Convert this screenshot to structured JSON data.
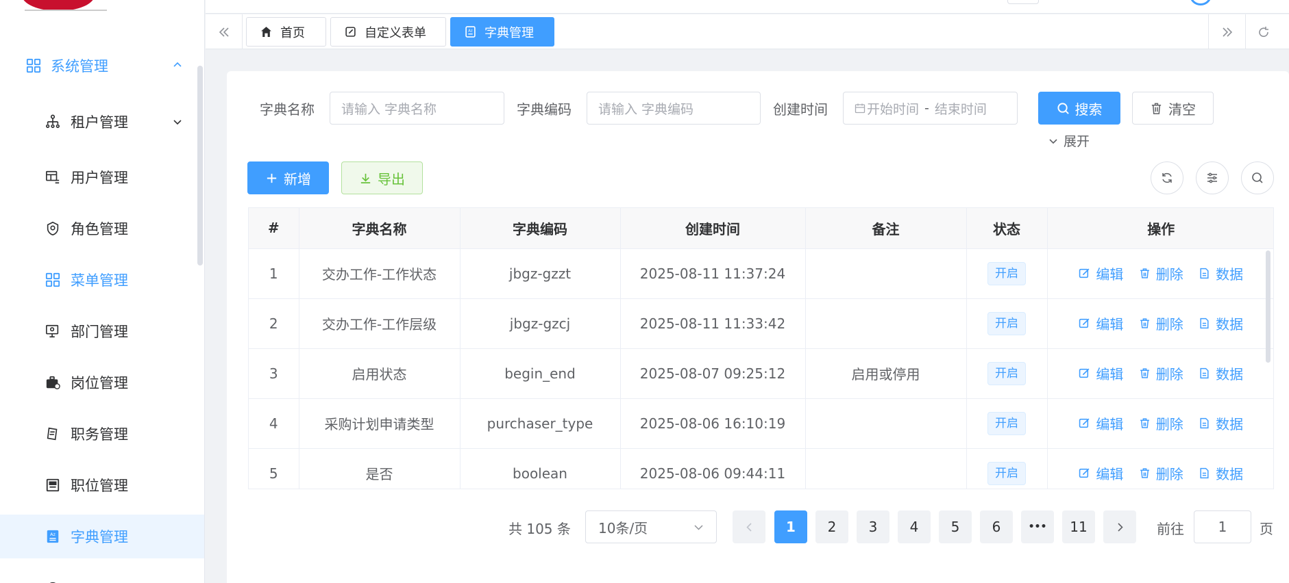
{
  "sidebar": {
    "group": {
      "label": "系统管理"
    },
    "items": [
      {
        "label": "租户管理"
      },
      {
        "label": "用户管理"
      },
      {
        "label": "角色管理"
      },
      {
        "label": "菜单管理"
      },
      {
        "label": "部门管理"
      },
      {
        "label": "岗位管理"
      },
      {
        "label": "职务管理"
      },
      {
        "label": "职位管理"
      },
      {
        "label": "字典管理"
      }
    ]
  },
  "tabs": [
    {
      "label": "首页"
    },
    {
      "label": "自定义表单"
    },
    {
      "label": "字典管理"
    }
  ],
  "search": {
    "name_label": "字典名称",
    "name_placeholder": "请输入 字典名称",
    "code_label": "字典编码",
    "code_placeholder": "请输入 字典编码",
    "time_label": "创建时间",
    "time_start": "开始时间",
    "time_sep": "-",
    "time_end": "结束时间",
    "search_btn": "搜索",
    "clear_btn": "清空",
    "expand": "展开"
  },
  "toolbar": {
    "add": "新增",
    "export": "导出"
  },
  "table": {
    "headers": [
      "#",
      "字典名称",
      "字典编码",
      "创建时间",
      "备注",
      "状态",
      "操作"
    ],
    "rows": [
      {
        "idx": "1",
        "name": "交办工作-工作状态",
        "code": "jbgz-gzzt",
        "time": "2025-08-11 11:37:24",
        "note": "",
        "status": "开启"
      },
      {
        "idx": "2",
        "name": "交办工作-工作层级",
        "code": "jbgz-gzcj",
        "time": "2025-08-11 11:33:42",
        "note": "",
        "status": "开启"
      },
      {
        "idx": "3",
        "name": "启用状态",
        "code": "begin_end",
        "time": "2025-08-07 09:25:12",
        "note": "启用或停用",
        "status": "开启"
      },
      {
        "idx": "4",
        "name": "采购计划申请类型",
        "code": "purchaser_type",
        "time": "2025-08-06 16:10:19",
        "note": "",
        "status": "开启"
      },
      {
        "idx": "5",
        "name": "是否",
        "code": "boolean",
        "time": "2025-08-06 09:44:11",
        "note": "",
        "status": "开启"
      }
    ],
    "ops": {
      "edit": "编辑",
      "delete": "删除",
      "data": "数据"
    }
  },
  "pagination": {
    "total": "共 105 条",
    "page_size": "10条/页",
    "pages": [
      "1",
      "2",
      "3",
      "4",
      "5",
      "6",
      "•••",
      "11"
    ],
    "current": "1",
    "goto_prefix": "前往",
    "goto_value": "1",
    "goto_suffix": "页"
  },
  "colors": {
    "primary": "#409eff",
    "success": "#67c23a",
    "active_bg": "#ecf5ff"
  }
}
